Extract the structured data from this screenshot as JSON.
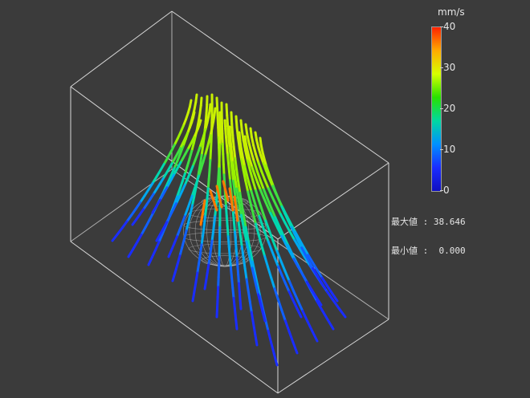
{
  "legend": {
    "unit": "mm/s",
    "ticks": [
      "40",
      "30",
      "20",
      "10",
      "0"
    ],
    "min_value": 0,
    "max_value": 40,
    "colors": [
      "#ff2200",
      "#ffaa00",
      "#d7ff00",
      "#28e000",
      "#00d8a0",
      "#0090ff",
      "#1a2dff",
      "#1010c0"
    ]
  },
  "stats": {
    "max_label": "最大値 : 38.646",
    "min_label": "最小値 :  0.000"
  },
  "scene": {
    "box_color": "#d8d8d8",
    "sphere_color": "#cfcfcf"
  }
}
